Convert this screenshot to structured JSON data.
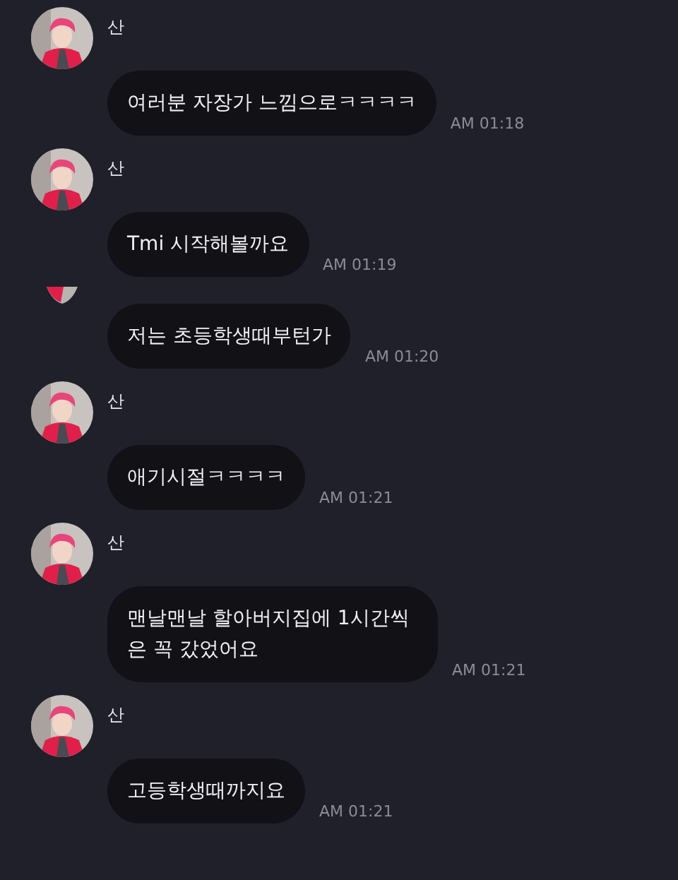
{
  "messages": [
    {
      "kind": "header",
      "sender": "산",
      "text": "여러분 자장가 느낌으로ㅋㅋㅋㅋ",
      "time": "AM 01:18"
    },
    {
      "kind": "header",
      "sender": "산",
      "text": "Tmi 시작해볼까요",
      "time": "AM 01:19"
    },
    {
      "kind": "clipped",
      "text": "저는 초등학생때부턴가",
      "time": "AM 01:20"
    },
    {
      "kind": "header",
      "sender": "산",
      "text": "애기시절ㅋㅋㅋㅋ",
      "time": "AM 01:21"
    },
    {
      "kind": "header",
      "sender": "산",
      "text": "맨날맨날 할아버지집에 1시간씩은 꼭 갔었어요",
      "time": "AM 01:21"
    },
    {
      "kind": "header",
      "sender": "산",
      "text": "고등학생때까지요",
      "time": "AM 01:21"
    }
  ]
}
